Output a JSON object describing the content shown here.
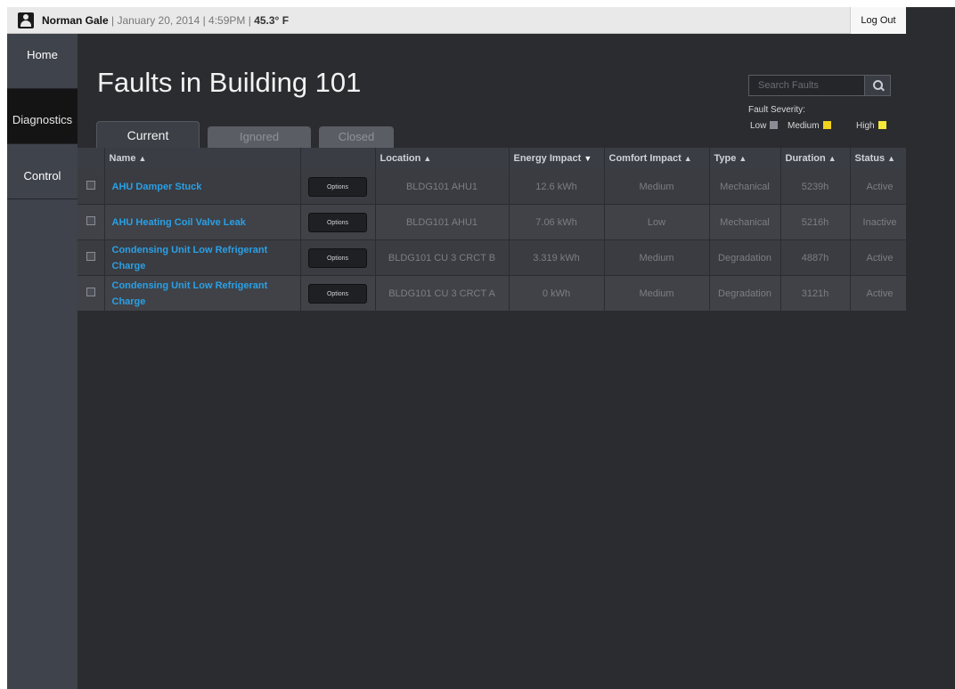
{
  "header": {
    "user_name": "Norman Gale",
    "date": "January 20, 2014",
    "time": "4:59PM",
    "temperature": "45.3° F",
    "logout_label": "Log Out"
  },
  "sidebar": {
    "items": [
      {
        "label": "Home"
      },
      {
        "label": "Diagnostics"
      },
      {
        "label": "Control"
      }
    ],
    "active_index": 1
  },
  "main": {
    "title": "Faults in Building 101",
    "search_placeholder": "Search Faults",
    "severity": {
      "label": "Fault Severity:",
      "levels": [
        {
          "label": "Low",
          "color": "#8a8d93"
        },
        {
          "label": "Medium",
          "color": "#f1d21c"
        },
        {
          "label": "High",
          "color": "#f7e93a"
        }
      ]
    },
    "tabs": [
      {
        "label": "Current",
        "active": true
      },
      {
        "label": "Ignored",
        "active": false
      },
      {
        "label": "Closed",
        "active": false
      }
    ],
    "table": {
      "columns": {
        "name": "Name",
        "location": "Location",
        "energy": "Energy Impact",
        "comfort": "Comfort Impact",
        "type": "Type",
        "duration": "Duration",
        "status": "Status"
      },
      "options_label": "Options",
      "rows": [
        {
          "name": "AHU Damper Stuck",
          "location": "BLDG101 AHU1",
          "energy": "12.6 kWh",
          "comfort": "Medium",
          "type": "Mechanical",
          "duration": "5239h",
          "status": "Active"
        },
        {
          "name": "AHU Heating Coil Valve Leak",
          "location": "BLDG101 AHU1",
          "energy": "7.06 kWh",
          "comfort": "Low",
          "type": "Mechanical",
          "duration": "5216h",
          "status": "Inactive"
        },
        {
          "name": "Condensing Unit Low Refrigerant Charge",
          "location": "BLDG101 CU 3 CRCT B",
          "energy": "3.319 kWh",
          "comfort": "Medium",
          "type": "Degradation",
          "duration": "4887h",
          "status": "Active"
        },
        {
          "name": "Condensing Unit Low Refrigerant Charge",
          "location": "BLDG101 CU 3 CRCT A",
          "energy": "0 kWh",
          "comfort": "Medium",
          "type": "Degradation",
          "duration": "3121h",
          "status": "Active"
        }
      ]
    }
  }
}
